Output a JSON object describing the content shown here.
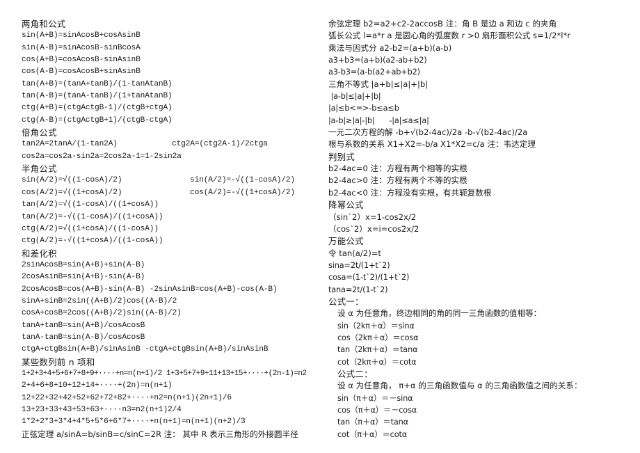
{
  "left": {
    "sum_angle": {
      "title": "两角和公式",
      "lines": [
        "sin(A+B)=sinAcosB+cosAsinB",
        "sin(A-B)=sinAcosB-sinBcosA",
        "cos(A+B)=cosAcosB-sinAsinB",
        "cos(A-B)=cosAcosB+sinAsinB",
        "tan(A+B)=(tanA+tanB)/(1-tanAtanB)",
        "tan(A-B)=(tanA-tanB)/(1+tanAtanB)",
        "ctg(A+B)=(ctgActgB-1)/(ctgB+ctgA)",
        "ctg(A-B)=(ctgActgB+1)/(ctgB-ctgA)"
      ]
    },
    "double_angle": {
      "title": "倍角公式",
      "line1_left": "tan2A=2tanA/(1-tan2A)",
      "line1_right": "ctg2A=(ctg2A-1)/2ctga",
      "line2": "cos2a=cos2a-sin2a=2cos2a-1=1-2sin2a"
    },
    "half_angle": {
      "title": "半角公式",
      "pairs": [
        {
          "left": "sin(A/2)=√((1-cosA)/2)",
          "right": "sin(A/2)=-√((1-cosA)/2)"
        },
        {
          "left": "cos(A/2)=√((1+cosA)/2)",
          "right": "cos(A/2)=-√((1+cosA)/2)"
        }
      ],
      "lines": [
        "tan(A/2)=√((1-cosA)/((1+cosA))",
        "tan(A/2)=-√((1-cosA)/((1+cosA))",
        "ctg(A/2)=√((1+cosA)/((1-cosA))",
        "ctg(A/2)=-√((1+cosA)/((1-cosA))"
      ]
    },
    "sum_to_product": {
      "title": "和差化积",
      "lines": [
        "2sinAcosB=sin(A+B)+sin(A-B)",
        "2cosAsinB=sin(A+B)-sin(A-B)",
        "2cosAcosB=cos(A+B)-sin(A-B) -2sinAsinB=cos(A+B)-cos(A-B)",
        "sinA+sinB=2sin((A+B)/2)cos((A-B)/2",
        "cosA+cosB=2cos((A+B)/2)sin((A-B)/2)",
        "tanA+tanB=sin(A+B)/cosAcosB",
        "tanA-tanB=sin(A-B)/cosAcosB",
        "ctgA+ctgBsin(A+B)/sinAsinB -ctgA+ctgBsin(A+B)/sinAsinB"
      ]
    },
    "series_sums": {
      "title": "某些数列前 n 项和",
      "lines": [
        "1+2+3+4+5+6+7+8+9+····+n=n(n+1)/2 1+3+5+7+9+11+13+15+····+(2n-1)=n2",
        "2+4+6+8+10+12+14+····+(2n)=n(n+1)",
        "12+22+32+42+52+62+72+82+····+n2=n(n+1)(2n+1)/6",
        "13+23+33+43+53+63+····n3=n2(n+1)2/4",
        "1*2+2*3+3*4+4*5+5*6+6*7+····+n(n+1)=n(n+1)(n+2)/3"
      ]
    },
    "sine_law": "正弦定理 a/sinA=b/sinB=c/sinC=2R 注： 其中 R 表示三角形的外接圆半径"
  },
  "right": {
    "cosine_law": "余弦定理 b2=a2+c2-2accosB 注：角 B 是边 a 和边 c 的夹角",
    "arc_length": "弧长公式 l=a*r a 是圆心角的弧度数 r >0 扇形面积公式 s=1/2*l*r",
    "factoring": {
      "lines": [
        "乘法与因式分 a2-b2=(a+b)(a-b)",
        "a3+b3=(a+b)(a2-ab+b2)",
        "a3-b3=(a-b(a2+ab+b2)"
      ]
    },
    "triangle_inequality": {
      "lines": [
        "三角不等式 |a+b|≤|a|+|b|",
        " |a-b|≤|a|+|b|",
        "|a|≤b<=>-b≤a≤b",
        "|a-b|≥|a|-|b|      -|a|≤a≤|a|"
      ]
    },
    "quadratic": {
      "solution": "一元二次方程的解 -b+√(b2-4ac)/2a -b-√(b2-4ac)/2a",
      "vieta": "根与系数的关系 X1+X2=-b/a X1*X2=c/a 注：韦达定理"
    },
    "discriminant": {
      "title": "判别式",
      "lines": [
        "b2-4ac=0 注：方程有两个相等的实根",
        "b2-4ac>0 注：方程有两个不等的实根",
        "b2-4ac<0 注：方程没有实根，有共轭复数根"
      ]
    },
    "power_reduction": {
      "title": "降幂公式",
      "lines": [
        "（sin`2）x=1-cos2x/2",
        "（cos`2）x=i=cos2x/2"
      ]
    },
    "universal": {
      "title": "万能公式",
      "lines": [
        "令 tan(a/2)=t",
        "sina=2t/(1+t`2)",
        "cosa=(1-t`2)/(1+t`2)",
        "tana=2t/(1-t`2)"
      ]
    },
    "formula_one": {
      "title": "公式一：",
      "intro": "设 α 为任意角，终边相同的角的同一三角函数的值相等：",
      "lines": [
        "sin（2kπ＋α）＝sinα",
        "cos（2kπ＋α）＝cosα",
        "tan（2kπ＋α）＝tanα",
        "cot（2kπ＋α）＝cotα"
      ]
    },
    "formula_two": {
      "title": "公式二：",
      "intro": "设 α 为任意角， π+α 的三角函数值与 α 的三角函数值之间的关系：",
      "lines": [
        "sin（π＋α）＝－sinα",
        "cos（π＋α）＝－cosα",
        "tan（π＋α）＝tanα",
        "cot（π＋α）＝cotα"
      ]
    }
  }
}
